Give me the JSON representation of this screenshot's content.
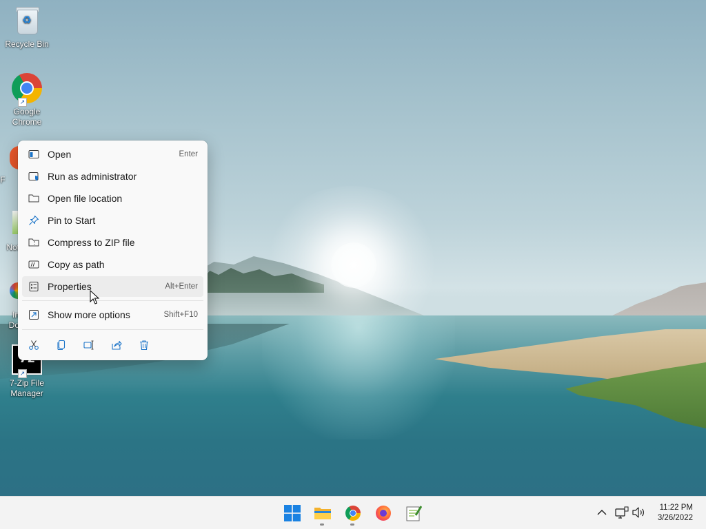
{
  "desktop": {
    "icons": [
      {
        "label": "Recycle Bin",
        "icon": "recycle-bin-icon"
      },
      {
        "label": "Google\nChrome",
        "icon": "chrome-icon"
      },
      {
        "label": "7-Zip File\nManager",
        "icon": "7zip-icon"
      }
    ],
    "partial_labels": [
      "F",
      "Not",
      "In",
      "Do"
    ]
  },
  "context_menu": {
    "items": [
      {
        "label": "Open",
        "shortcut": "Enter",
        "icon": "open-window-icon"
      },
      {
        "label": "Run as administrator",
        "shortcut": "",
        "icon": "shield-window-icon"
      },
      {
        "label": "Open file location",
        "shortcut": "",
        "icon": "folder-icon"
      },
      {
        "label": "Pin to Start",
        "shortcut": "",
        "icon": "pin-icon"
      },
      {
        "label": "Compress to ZIP file",
        "shortcut": "",
        "icon": "zip-folder-icon"
      },
      {
        "label": "Copy as path",
        "shortcut": "",
        "icon": "copy-path-icon"
      },
      {
        "label": "Properties",
        "shortcut": "Alt+Enter",
        "icon": "properties-icon",
        "hovered": true
      },
      {
        "label": "Show more options",
        "shortcut": "Shift+F10",
        "icon": "more-options-icon"
      }
    ],
    "actions": [
      "cut-icon",
      "copy-icon",
      "rename-icon",
      "share-icon",
      "delete-icon"
    ]
  },
  "taskbar": {
    "apps": [
      "start-icon",
      "file-explorer-icon",
      "chrome-icon",
      "firefox-icon",
      "notepad-plus-icon"
    ],
    "tray": [
      "chevron-up-icon",
      "network-icon",
      "volume-icon"
    ],
    "clock": {
      "time": "11:22 PM",
      "date": "3/26/2022"
    }
  },
  "colors": {
    "accent": "#0067c0",
    "menu_bg": "#f9f9f9",
    "taskbar_bg": "#f3f3f3"
  }
}
